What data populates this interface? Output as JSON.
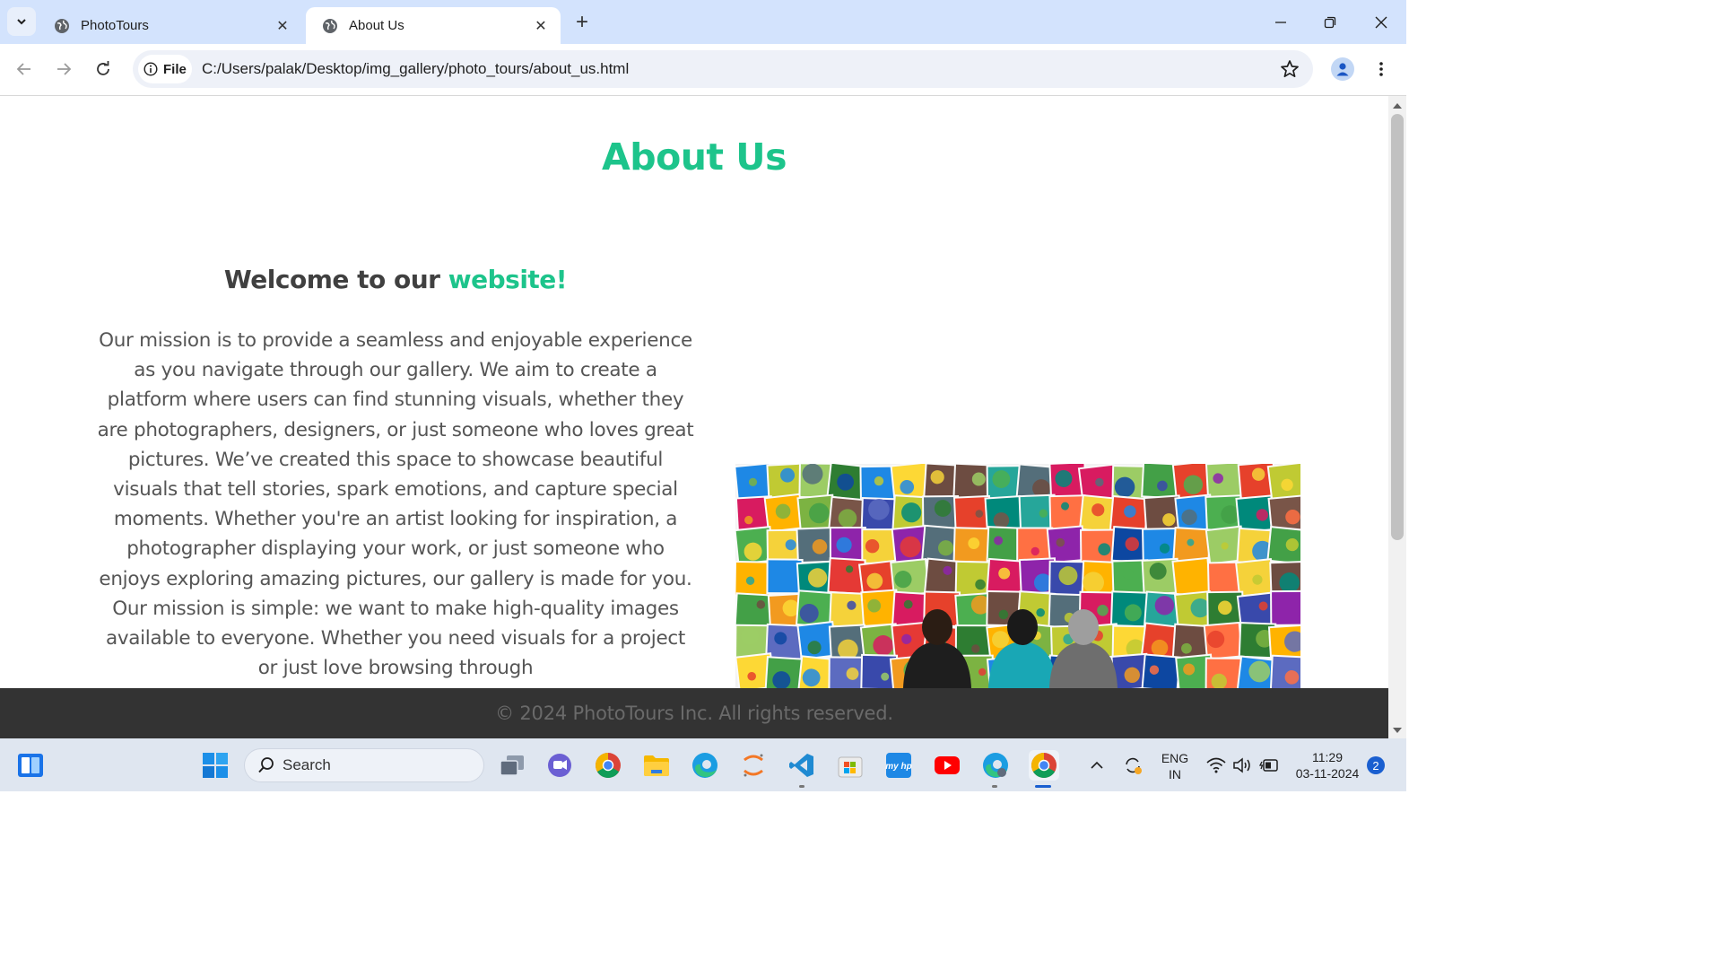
{
  "browser": {
    "tabs": [
      {
        "title": "PhotoTours",
        "active": false
      },
      {
        "title": "About Us",
        "active": true
      }
    ],
    "site_chip": "File",
    "url": "C:/Users/palak/Desktop/img_gallery/photo_tours/about_us.html"
  },
  "page": {
    "title": "About Us",
    "welcome_prefix": "Welcome to our",
    "welcome_highlight": "website!",
    "mission": "Our mission is to provide a seamless and enjoyable experience as you navigate through our gallery. We aim to create a platform where users can find stunning visuals, whether they are photographers, designers, or just someone who loves great pictures. We’ve created this space to showcase beautiful visuals that tell stories, spark emotions, and capture special moments. Whether you're an artist looking for inspiration, a photographer displaying your work, or just someone who enjoys exploring amazing pictures, our gallery is made for you. Our mission is simple: we want to make high-quality images available to everyone. Whether you need visuals for a project or just love browsing through",
    "footer": "© 2024 PhotoTours Inc. All rights reserved.",
    "accent_color": "#1dc48b"
  },
  "taskbar": {
    "search_label": "Search",
    "lang_primary": "ENG",
    "lang_secondary": "IN",
    "time": "11:29",
    "date": "03-11-2024",
    "notification_count": "2"
  }
}
